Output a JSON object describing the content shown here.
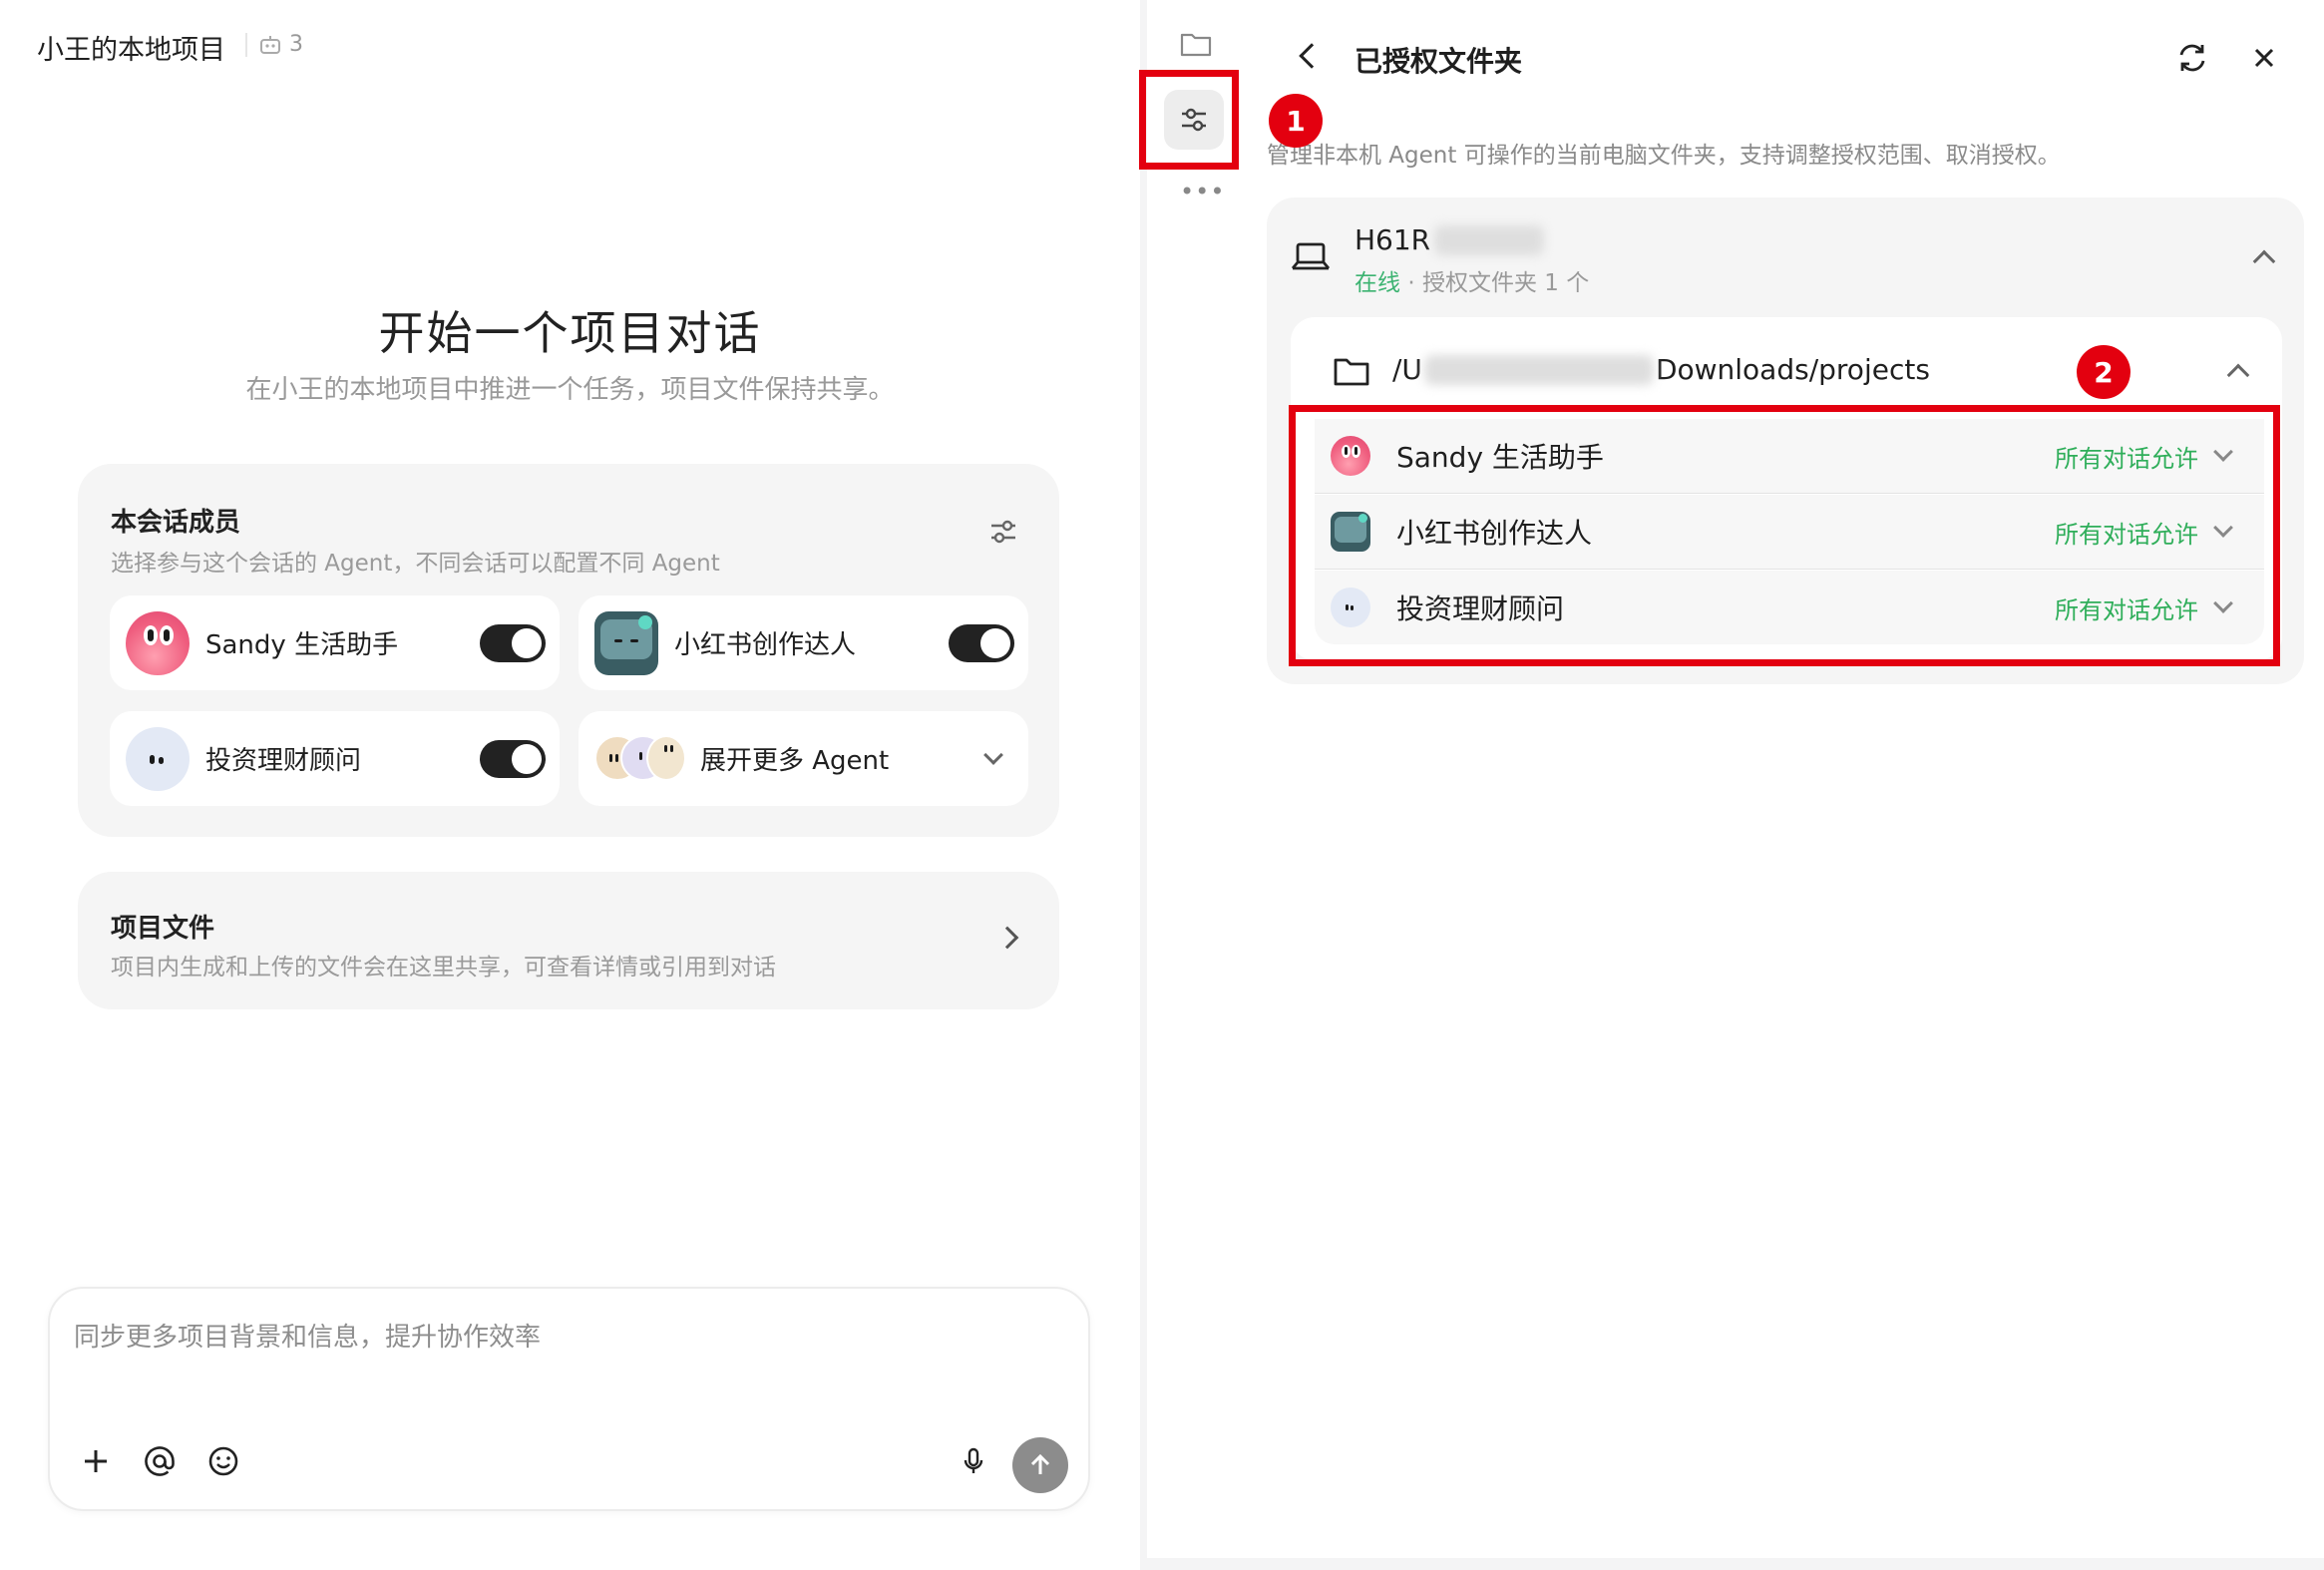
{
  "header": {
    "project_title": "小王的本地项目",
    "member_count": "3",
    "member_icon": "robot-icon"
  },
  "center": {
    "title": "开始一个项目对话",
    "subtitle": "在小王的本地项目中推进一个任务，项目文件保持共享。"
  },
  "members": {
    "title": "本会话成员",
    "subtitle": "选择参与这个会话的 Agent，不同会话可以配置不同 Agent",
    "agents": [
      {
        "name": "Sandy 生活助手",
        "enabled": true
      },
      {
        "name": "小红书创作达人",
        "enabled": true
      },
      {
        "name": "投资理财顾问",
        "enabled": true
      }
    ],
    "expand_label": "展开更多 Agent"
  },
  "project_files": {
    "title": "项目文件",
    "subtitle": "项目内生成和上传的文件会在这里共享，可查看详情或引用到对话"
  },
  "input": {
    "placeholder": "同步更多项目背景和信息，提升协作效率"
  },
  "right_panel": {
    "title": "已授权文件夹",
    "description": "管理非本机 Agent 可操作的当前电脑文件夹，支持调整授权范围、取消授权。",
    "device": {
      "name": "H61R",
      "status": "在线",
      "folder_count": "授权文件夹 1 个",
      "separator": "·"
    },
    "folder": {
      "path_prefix": "/U",
      "path_suffix": "Downloads/projects"
    },
    "permissions": [
      {
        "agent": "Sandy 生活助手",
        "scope": "所有对话允许"
      },
      {
        "agent": "小红书创作达人",
        "scope": "所有对话允许"
      },
      {
        "agent": "投资理财顾问",
        "scope": "所有对话允许"
      }
    ]
  },
  "annotations": {
    "badge_1": "1",
    "badge_2": "2"
  },
  "colors": {
    "accent_green": "#2fae5a",
    "annotation_red": "#e3000f",
    "online_green": "#3cb371"
  }
}
